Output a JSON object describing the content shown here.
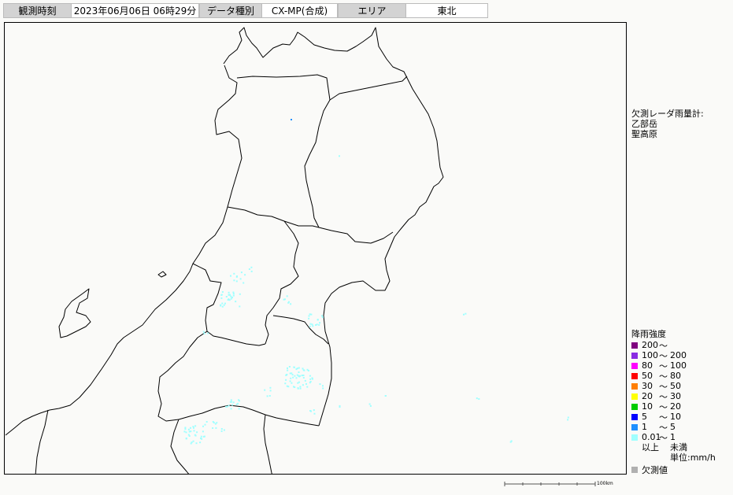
{
  "header": {
    "obs_time_label": "観測時刻",
    "obs_time_value": "2023年06月06日 06時29分",
    "data_type_label": "データ種別",
    "data_type_value": "CX-MP(合成)",
    "area_label": "エリア",
    "area_value": "東北"
  },
  "missing_radar": {
    "title": "欠測レーダ雨量計:",
    "stations": [
      "乙部岳",
      "聖高原"
    ]
  },
  "legend": {
    "title": "降雨強度",
    "rows": [
      {
        "min": "200",
        "max": "",
        "color": "#800080"
      },
      {
        "min": "100",
        "max": "200",
        "color": "#8a2be2"
      },
      {
        "min": "80",
        "max": "100",
        "color": "#ff00ff"
      },
      {
        "min": "50",
        "max": "80",
        "color": "#ff0000"
      },
      {
        "min": "30",
        "max": "50",
        "color": "#ff7f00"
      },
      {
        "min": "20",
        "max": "30",
        "color": "#ffff00"
      },
      {
        "min": "10",
        "max": "20",
        "color": "#00cc00"
      },
      {
        "min": "5",
        "max": "10",
        "color": "#0000ff"
      },
      {
        "min": "1",
        "max": "5",
        "color": "#1e90ff"
      },
      {
        "min": "0.01",
        "max": "1",
        "color": "#a0ffff"
      }
    ],
    "range_sep": "〜",
    "above_label": "以上",
    "below_label": "未満",
    "unit_label": "単位:mm/h",
    "missing_label": "欠測値",
    "missing_color": "#b0b0b0"
  },
  "scale_bar": {
    "label": "100km"
  },
  "colors": {
    "rain_light": "#a0ffff",
    "rain_blue": "#1e90ff",
    "boundary": "#000000",
    "background": "#fafaf8"
  }
}
